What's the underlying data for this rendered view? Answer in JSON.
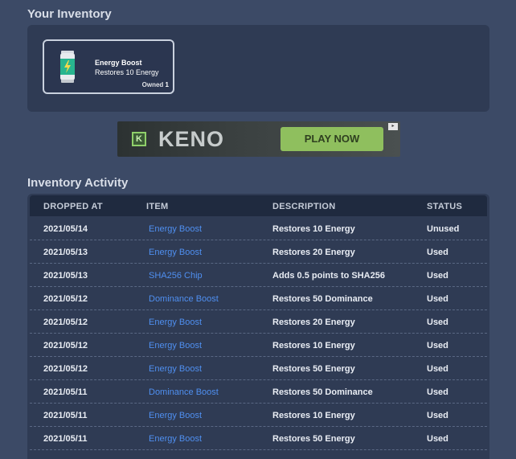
{
  "inventory": {
    "title": "Your Inventory",
    "items": [
      {
        "name": "Energy Boost",
        "description": "Restores 10 Energy",
        "owned_label": "Owned",
        "owned_count": "1",
        "icon": "energy-can-icon"
      }
    ]
  },
  "banner": {
    "logo_letter": "K",
    "logo_text": "KENO",
    "cta": "PLAY NOW"
  },
  "activity": {
    "title": "Inventory Activity",
    "columns": [
      "DROPPED AT",
      "ITEM",
      "DESCRIPTION",
      "STATUS"
    ],
    "rows": [
      {
        "date": "2021/05/14",
        "item": "Energy Boost",
        "description": "Restores 10 Energy",
        "status": "Unused"
      },
      {
        "date": "2021/05/13",
        "item": "Energy Boost",
        "description": "Restores 20 Energy",
        "status": "Used"
      },
      {
        "date": "2021/05/13",
        "item": "SHA256 Chip",
        "description": "Adds 0.5 points to SHA256",
        "status": "Used"
      },
      {
        "date": "2021/05/12",
        "item": "Dominance Boost",
        "description": "Restores 50 Dominance",
        "status": "Used"
      },
      {
        "date": "2021/05/12",
        "item": "Energy Boost",
        "description": "Restores 20 Energy",
        "status": "Used"
      },
      {
        "date": "2021/05/12",
        "item": "Energy Boost",
        "description": "Restores 10 Energy",
        "status": "Used"
      },
      {
        "date": "2021/05/12",
        "item": "Energy Boost",
        "description": "Restores 50 Energy",
        "status": "Used"
      },
      {
        "date": "2021/05/11",
        "item": "Dominance Boost",
        "description": "Restores 50 Dominance",
        "status": "Used"
      },
      {
        "date": "2021/05/11",
        "item": "Energy Boost",
        "description": "Restores 10 Energy",
        "status": "Used"
      },
      {
        "date": "2021/05/11",
        "item": "Energy Boost",
        "description": "Restores 50 Energy",
        "status": "Used"
      }
    ]
  }
}
